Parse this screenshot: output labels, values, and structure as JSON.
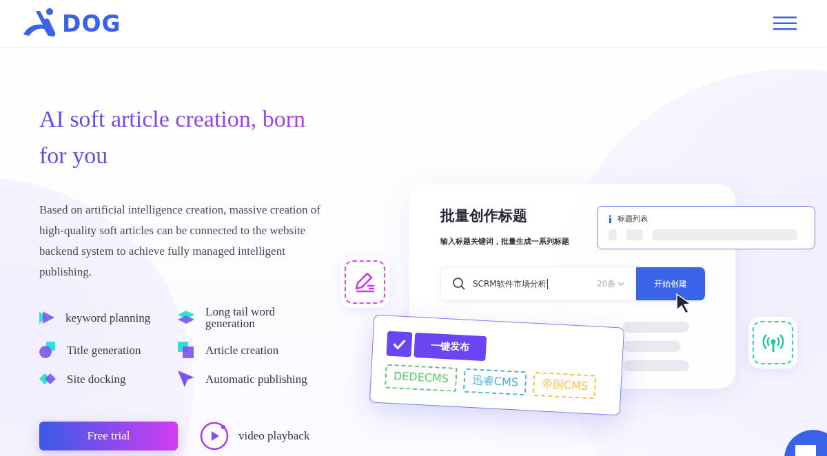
{
  "header": {
    "logo_text": "DOG"
  },
  "hero": {
    "title_line1": "AI soft article creation, born",
    "title_line2": "for you",
    "description": "Based on artificial intelligence creation, massive creation of high-quality soft articles can be connected to the website backend system to achieve fully managed intelligent publishing.",
    "features": [
      {
        "kind": "play",
        "label": "keyword planning"
      },
      {
        "kind": "layers",
        "label": "Long tail word generation"
      },
      {
        "kind": "dot-square",
        "label": "Title generation"
      },
      {
        "kind": "squares",
        "label": "Article creation"
      },
      {
        "kind": "diamonds",
        "label": "Site docking"
      },
      {
        "kind": "send",
        "label": "Automatic publishing"
      }
    ],
    "primary_button": "Free trial",
    "video_link": "video playback"
  },
  "illustration": {
    "card_title": "批量创作标题",
    "card_subtitle": "输入标题关键词，批量生成一系列标题",
    "search": {
      "value": "SCRM软件市场分析",
      "count": "20条",
      "button": "开始创建"
    },
    "title_list": {
      "label": "标题列表"
    },
    "publish": {
      "checked": true,
      "button": "一键发布",
      "tags": [
        {
          "label": "DEDECMS",
          "color": "#5cc96a"
        },
        {
          "label": "迅睿CMS",
          "color": "#4fb0e0"
        },
        {
          "label": "帝国CMS",
          "color": "#f2c23a"
        }
      ]
    }
  }
}
